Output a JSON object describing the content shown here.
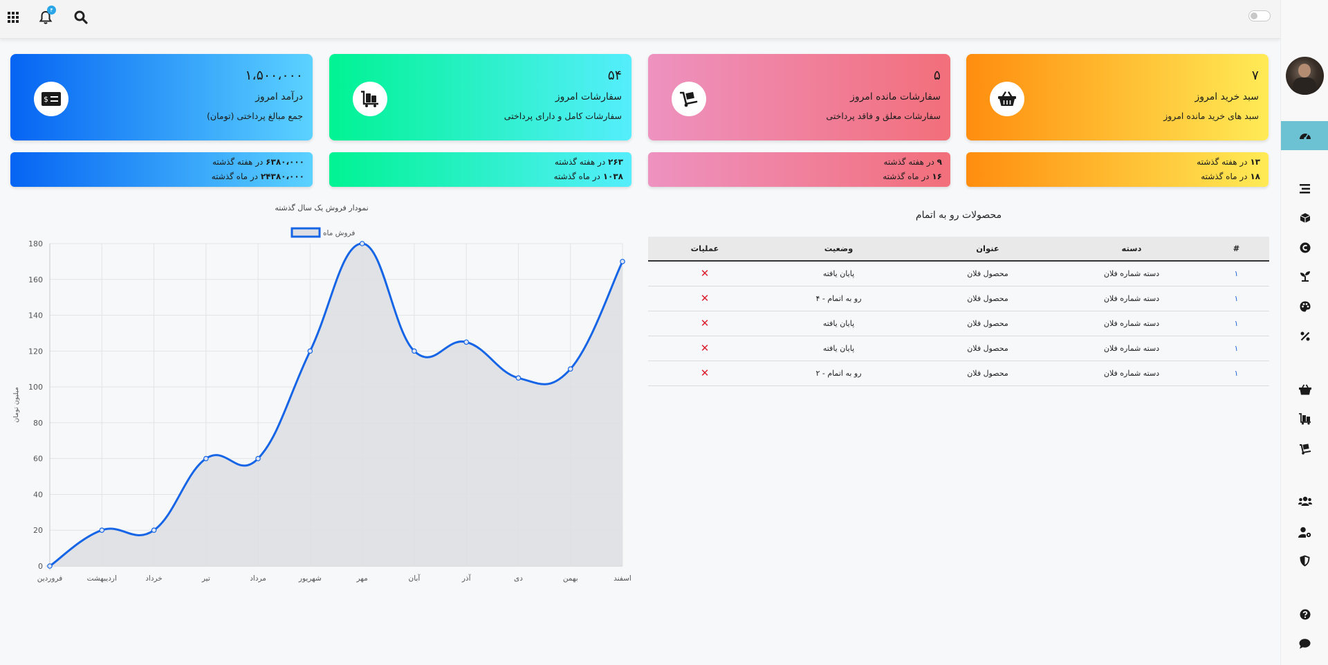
{
  "topbar": {
    "notification_count": "۴"
  },
  "cards": [
    {
      "value": "۷",
      "title": "سبد خرید امروز",
      "subtitle": "سبد های خرید مانده امروز",
      "week": "۱۳",
      "week_text": "در هفته گذشته",
      "month": "۱۸",
      "month_text": "در ماه گذشته",
      "icon": "basket-icon"
    },
    {
      "value": "۵",
      "title": "سفارشات مانده امروز",
      "subtitle": "سفارشات معلق و فاقد پرداختی",
      "week": "۹",
      "week_text": "در هفته گذشته",
      "month": "۱۶",
      "month_text": "در ماه گذشته",
      "icon": "cart-dolly-icon"
    },
    {
      "value": "۵۴",
      "title": "سفارشات امروز",
      "subtitle": "سفارشات کامل و دارای پرداختی",
      "week": "۲۶۳",
      "week_text": "در هفته گذشته",
      "month": "۱۰۳۸",
      "month_text": "در ماه گذشته",
      "icon": "luggage-cart-icon"
    },
    {
      "value": "۱،۵۰۰،۰۰۰",
      "title": "درآمد امروز",
      "subtitle": "جمع مبالغ پرداختی (تومان)",
      "week": "۶۳۸۰،۰۰۰",
      "week_text": "در هفته گذشته",
      "month": "۲۴۳۸۰،۰۰۰",
      "month_text": "در ماه گذشته",
      "icon": "money-check-icon"
    }
  ],
  "table": {
    "title": "محصولات رو به اتمام",
    "headers": [
      "#",
      "دسته",
      "عنوان",
      "وضعیت",
      "عملیات"
    ],
    "rows": [
      {
        "num": "۱",
        "category": "دسته شماره فلان",
        "title": "محصول فلان",
        "status": "پایان یافته"
      },
      {
        "num": "۱",
        "category": "دسته شماره فلان",
        "title": "محصول فلان",
        "status": "رو به اتمام - ۴"
      },
      {
        "num": "۱",
        "category": "دسته شماره فلان",
        "title": "محصول فلان",
        "status": "پایان یافته"
      },
      {
        "num": "۱",
        "category": "دسته شماره فلان",
        "title": "محصول فلان",
        "status": "پایان یافته"
      },
      {
        "num": "۱",
        "category": "دسته شماره فلان",
        "title": "محصول فلان",
        "status": "رو به اتمام - ۲"
      }
    ],
    "delete_symbol": "✕"
  },
  "chart_data": {
    "type": "line",
    "title": "نمودار فروش یک سال گذشته",
    "categories": [
      "فروردین",
      "اردیبهشت",
      "خرداد",
      "تیر",
      "مرداد",
      "شهریور",
      "مهر",
      "آبان",
      "آذر",
      "دی",
      "بهمن",
      "اسفند"
    ],
    "series": [
      {
        "name": "فروش ماه",
        "values": [
          0,
          20,
          20,
          60,
          60,
          120,
          180,
          120,
          125,
          105,
          110,
          170
        ]
      }
    ],
    "xlabel": "",
    "ylabel": "میلیون تومان",
    "ylim": [
      0,
      180
    ],
    "yticks": [
      0,
      20,
      40,
      60,
      80,
      100,
      120,
      140,
      160,
      180
    ],
    "grid": true,
    "legend": "top-center",
    "line_color": "#1565e6",
    "fill_color": "#dedfe2"
  },
  "sidebar": {
    "items": [
      "dashboard-icon",
      "list-icon",
      "box-icon",
      "copyright-icon",
      "seedling-icon",
      "palette-icon",
      "percent-icon",
      "basket-icon",
      "luggage-cart-icon",
      "dolly-icon",
      "users-icon",
      "user-gear-icon",
      "shield-icon",
      "question-icon",
      "comment-icon"
    ]
  }
}
